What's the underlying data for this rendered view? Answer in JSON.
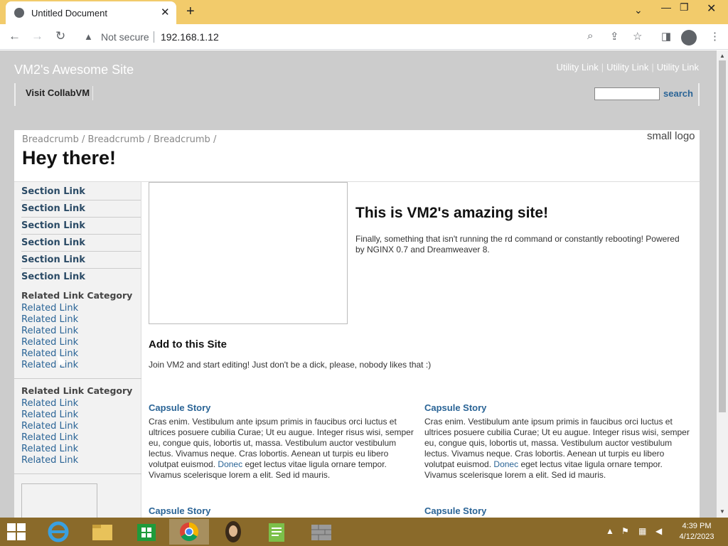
{
  "browser": {
    "tab_title": "Untitled Document",
    "new_tab": "+",
    "security_label": "Not secure",
    "url": "192.168.1.12"
  },
  "site": {
    "title": "VM2's Awesome Site",
    "utility_links": [
      "Utility Link",
      "Utility Link",
      "Utility Link"
    ],
    "nav_link": "Visit CollabVM",
    "search_label": "search",
    "breadcrumb": "Breadcrumb / Breadcrumb / Breadcrumb /",
    "page_title": "Hey there!",
    "logo_alt": "small logo",
    "section_links": [
      "Section Link",
      "Section Link",
      "Section Link",
      "Section Link",
      "Section Link",
      "Section Link"
    ],
    "related_category_1": "Related Link Category",
    "related_links_1": [
      "Related Link",
      "Related Link",
      "Related Link",
      "Related Link",
      "Related Link",
      "Related Link"
    ],
    "related_category_2": "Related Link Category",
    "related_links_2": [
      "Related Link",
      "Related Link",
      "Related Link",
      "Related Link",
      "Related Link",
      "Related Link"
    ],
    "hero_title": "This is VM2's amazing site!",
    "hero_text": "Finally, something that isn't running the rd command or constantly rebooting! Powered by NGINX 0.7 and Dreamweaver 8.",
    "add_title": "Add to this Site",
    "add_text": "Join VM2 and start editing! Just don't be a dick, please, nobody likes that :)",
    "capsules": [
      {
        "title": "Capsule Story",
        "text_before": "Cras enim. Vestibulum ante ipsum primis in faucibus orci luctus et ultrices posuere cubilia Curae; Ut eu augue. Integer risus wisi, semper eu, congue quis, lobortis ut, massa. Vestibulum auctor vestibulum lectus. Vivamus neque. Cras lobortis. Aenean ut turpis eu libero volutpat euismod.",
        "link": "Donec",
        "text_after": "eget lectus vitae ligula ornare tempor. Vivamus scelerisque lorem a elit. Sed id mauris."
      },
      {
        "title": "Capsule Story",
        "text_before": "Cras enim. Vestibulum ante ipsum primis in faucibus orci luctus et ultrices posuere cubilia Curae; Ut eu augue. Integer risus wisi, semper eu, congue quis, lobortis ut, massa. Vestibulum auctor vestibulum lectus. Vivamus neque. Cras lobortis. Aenean ut turpis eu libero volutpat euismod.",
        "link": "Donec",
        "text_after": "eget lectus vitae ligula ornare tempor. Vivamus scelerisque lorem a elit. Sed id mauris."
      },
      {
        "title": "Capsule Story"
      },
      {
        "title": "Capsule Story"
      }
    ]
  },
  "taskbar": {
    "apps": [
      "internet-explorer-icon",
      "file-explorer-icon",
      "store-icon",
      "chrome-icon",
      "portrait-app-icon",
      "notepad-icon",
      "firewall-icon"
    ],
    "time": "4:39 PM",
    "date": "4/12/2023"
  },
  "colors": {
    "tab_strip": "#f2cb6b",
    "page_bg": "#cccccc",
    "link": "#2a6496",
    "taskbar": "#8a6a2a"
  }
}
